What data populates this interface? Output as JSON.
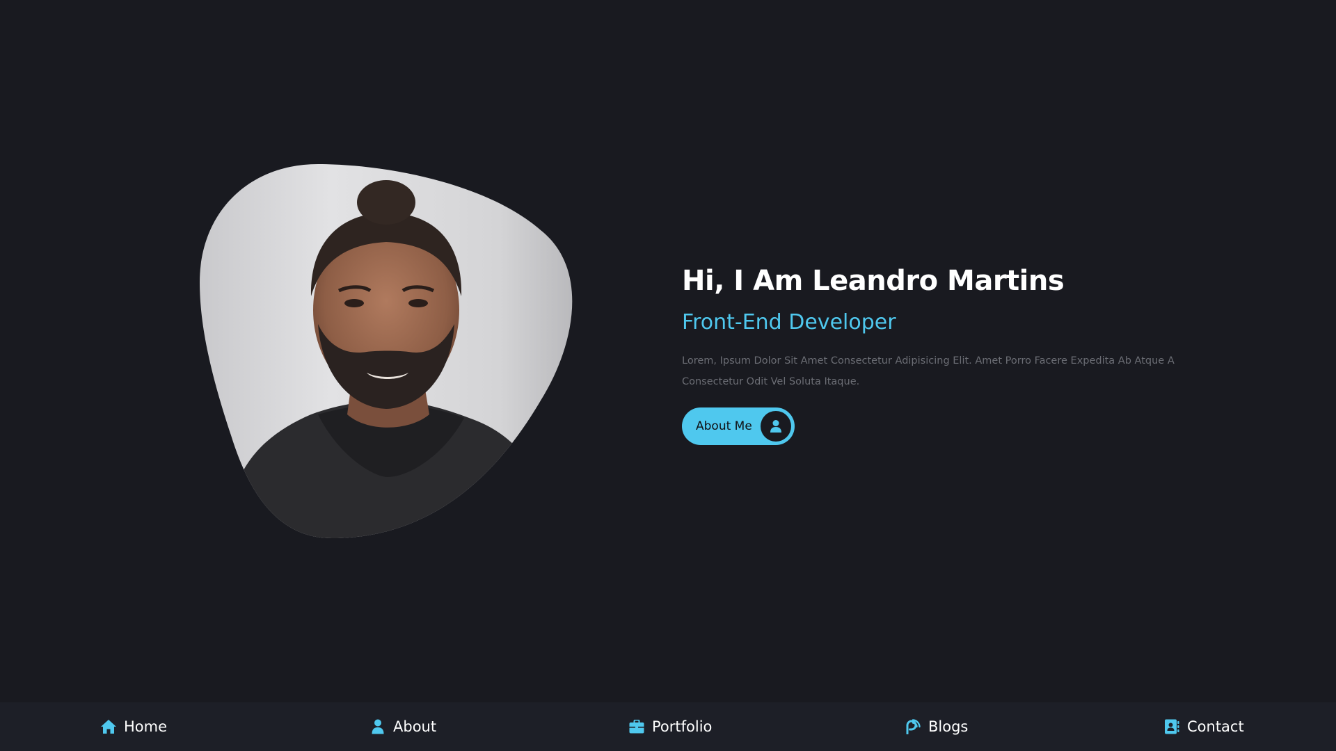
{
  "hero": {
    "title": "Hi, I Am Leandro Martins",
    "role": "Front-End Developer",
    "description": "Lorem, Ipsum Dolor Sit Amet Consectetur Adipisicing Elit. Amet Porro Facere Expedita Ab Atque A Consectetur Odit Vel Soluta Itaque.",
    "cta_label": "About Me",
    "cta_icon": "user-icon"
  },
  "nav": {
    "items": [
      {
        "label": "Home",
        "icon": "home-icon"
      },
      {
        "label": "About",
        "icon": "user-icon"
      },
      {
        "label": "Portfolio",
        "icon": "briefcase-icon"
      },
      {
        "label": "Blogs",
        "icon": "blog-icon"
      },
      {
        "label": "Contact",
        "icon": "contact-book-icon"
      }
    ]
  },
  "colors": {
    "background": "#191a20",
    "nav_background": "#1d1f27",
    "accent": "#4fc8ee",
    "text": "#ffffff",
    "muted_text": "#6b6d74"
  }
}
